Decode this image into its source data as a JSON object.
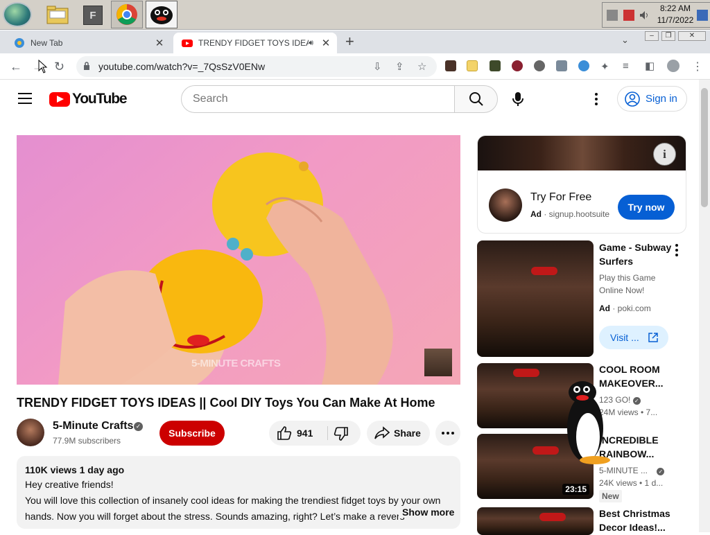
{
  "taskbar": {
    "f_label": "F",
    "clock_time": "8:22 AM",
    "clock_date": "11/7/2022"
  },
  "browser": {
    "tabs": [
      {
        "title": "New Tab"
      },
      {
        "title": "TRENDY FIDGET TOYS IDEAS"
      }
    ],
    "url": "youtube.com/watch?v=_7QsSzV0ENw"
  },
  "youtube": {
    "logo_text": "YouTube",
    "search_placeholder": "Search",
    "sign_in": "Sign in",
    "watermark": "5-MINUTE CRAFTS",
    "video_title": "TRENDY FIDGET TOYS IDEAS || Cool DIY Toys You Can Make At Home",
    "channel": {
      "name": "5-Minute Crafts",
      "subscribers": "77.9M subscribers"
    },
    "subscribe": "Subscribe",
    "likes": "941",
    "share": "Share",
    "description": {
      "meta": "110K views  1 day ago",
      "line1": "Hey creative friends!",
      "line2": "You will love this collection of insanely cool ideas for making the trendiest fidget toys by your own",
      "line3": "hands. Now you will forget about the stress. Sounds amazing, right? Let’s make a revers",
      "show_more": "Show more"
    },
    "ad": {
      "title": "Try For Free",
      "label": "Ad",
      "domain": "signup.hootsuite",
      "button": "Try now"
    },
    "sidebar": [
      {
        "title1": "Game - Subway",
        "title2": "Surfers",
        "sub1": "Play this Game",
        "sub2": "Online Now!",
        "ad_label": "Ad",
        "ad_domain": "poki.com",
        "visit": "Visit ..."
      },
      {
        "title1": "COOL ROOM",
        "title2": "MAKEOVER...",
        "channel": "123 GO!",
        "stats": "24M views  • 7..."
      },
      {
        "title1": "INCREDIBLE",
        "title2": "RAINBOW...",
        "channel": "5-MINUTE ...",
        "stats": "24K views  • 1 d...",
        "duration": "23:15",
        "badge": "New"
      },
      {
        "title1": "Best Christmas",
        "title2": "Decor Ideas!..."
      }
    ]
  },
  "colors": {
    "youtube_red": "#ff0000",
    "subscribe_red": "#cc0000",
    "link_blue": "#065fd4"
  }
}
